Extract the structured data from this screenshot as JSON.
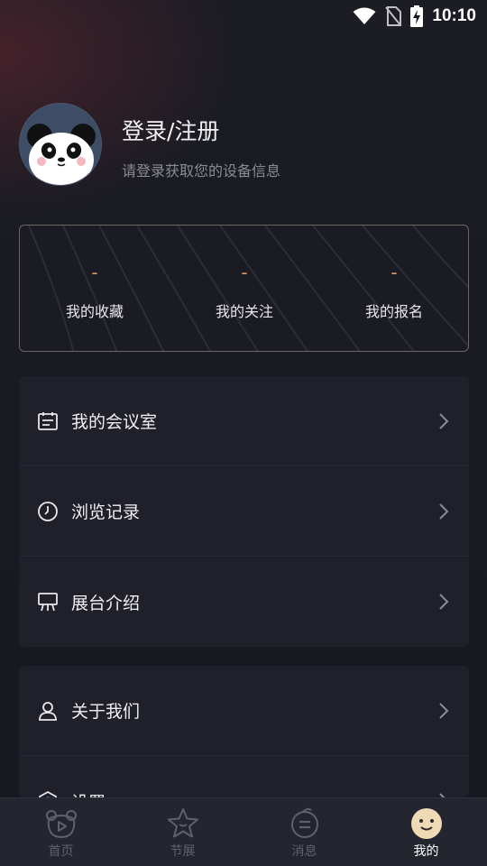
{
  "status_bar": {
    "time": "10:10",
    "icons": [
      "wifi-icon",
      "no-sim-icon",
      "battery-charging-icon"
    ]
  },
  "profile": {
    "avatar_icon": "panda-avatar-icon",
    "title": "登录/注册",
    "subtitle": "请登录获取您的设备信息"
  },
  "stats": [
    {
      "value": "-",
      "label": "我的收藏"
    },
    {
      "value": "-",
      "label": "我的关注"
    },
    {
      "value": "-",
      "label": "我的报名"
    }
  ],
  "menu_group_1": [
    {
      "label": "我的会议室",
      "icon": "meeting-room-icon"
    },
    {
      "label": "浏览记录",
      "icon": "clock-icon"
    },
    {
      "label": "展台介绍",
      "icon": "booth-icon"
    }
  ],
  "menu_group_2": [
    {
      "label": "关于我们",
      "icon": "person-icon"
    },
    {
      "label": "设置",
      "icon": "settings-icon"
    }
  ],
  "tabs": [
    {
      "label": "首页",
      "icon": "home-bear-icon",
      "active": false
    },
    {
      "label": "节展",
      "icon": "star-icon",
      "active": false
    },
    {
      "label": "消息",
      "icon": "message-icon",
      "active": false
    },
    {
      "label": "我的",
      "icon": "smiley-face-icon",
      "active": true
    }
  ],
  "colors": {
    "accent": "#e09a62",
    "background": "#15161d",
    "card": "#1f2029",
    "tab_active_icon": "#f0d9b5"
  }
}
